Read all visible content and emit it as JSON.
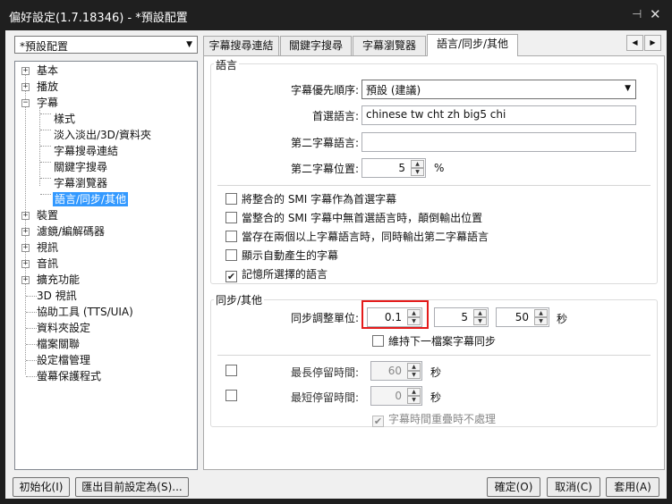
{
  "window": {
    "title": "偏好設定(1.7.18346) - *預設配置",
    "pin_glyph": "⊣",
    "close_glyph": "✕"
  },
  "profile_combo": {
    "value": "*預設配置"
  },
  "tree": {
    "items": [
      "基本",
      "播放",
      "字幕",
      "樣式",
      "淡入淡出/3D/資料夾",
      "字幕搜尋連結",
      "關鍵字搜尋",
      "字幕瀏覽器",
      "語言/同步/其他",
      "裝置",
      "濾鏡/編解碼器",
      "視訊",
      "音訊",
      "擴充功能",
      "3D 視訊",
      "協助工具 (TTS/UIA)",
      "資料夾設定",
      "檔案關聯",
      "設定檔管理",
      "螢幕保護程式"
    ],
    "selected": "語言/同步/其他"
  },
  "tabs": [
    "字幕搜尋連結",
    "關鍵字搜尋",
    "字幕瀏覽器",
    "語言/同步/其他"
  ],
  "active_tab": "語言/同步/其他",
  "language": {
    "group_title": "語言",
    "priority_label": "字幕優先順序:",
    "priority_value": "預設 (建議)",
    "primary_label": "首選語言:",
    "primary_value": "chinese tw cht zh big5 chi",
    "secondary_label": "第二字幕語言:",
    "secondary_value": "",
    "position_label": "第二字幕位置:",
    "position_value": "5",
    "position_unit": "%",
    "checkboxes": [
      {
        "label": "將整合的 SMI 字幕作為首選字幕",
        "checked": false
      },
      {
        "label": "當整合的 SMI 字幕中無首選語言時，顛倒輸出位置",
        "checked": false
      },
      {
        "label": "當存在兩個以上字幕語言時，同時輸出第二字幕語言",
        "checked": false
      },
      {
        "label": "顯示自動產生的字幕",
        "checked": false
      },
      {
        "label": "記憶所選擇的語言",
        "checked": true
      }
    ]
  },
  "sync": {
    "group_title": "同步/其他",
    "unit_label": "同步調整單位:",
    "unit_value": "0.1",
    "value2": "5",
    "value3": "50",
    "seconds": "秒",
    "keep_sync_label": "維持下一檔案字幕同步",
    "keep_sync_checked": false,
    "max_label": "最長停留時間:",
    "max_value": "60",
    "max_unit": "秒",
    "min_label": "最短停留時間:",
    "min_value": "0",
    "min_unit": "秒",
    "overlap_label": "字幕時間重疊時不處理",
    "overlap_checked": true
  },
  "buttons": {
    "init": "初始化(I)",
    "export": "匯出目前設定為(S)...",
    "ok": "確定(O)",
    "cancel": "取消(C)",
    "apply": "套用(A)"
  }
}
